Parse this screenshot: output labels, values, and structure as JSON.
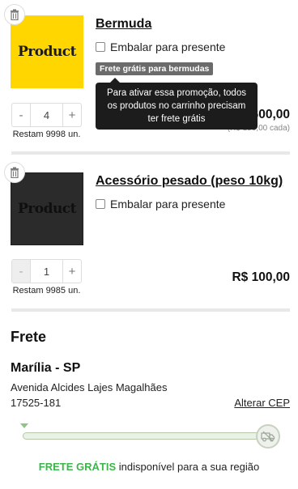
{
  "cart": {
    "items": [
      {
        "thumb_text": "Product",
        "name": "Bermuda",
        "gift_label": "Embalar para presente",
        "promo_badge": "Frete grátis para bermudas",
        "tooltip": "Para ativar essa promoção, todos os produtos no carrinho precisam ter frete grátis",
        "quantity": "4",
        "stock": "Restam 9998 un.",
        "price": "R$ 600,00",
        "unit_price": "(R$ 150,00 cada)",
        "decrement": "-",
        "increment": "+"
      },
      {
        "thumb_text": "Product",
        "name": "Acessório pesado (peso 10kg)",
        "gift_label": "Embalar para presente",
        "quantity": "1",
        "stock": "Restam 9985 un.",
        "price": "R$ 100,00",
        "decrement": "-",
        "increment": "+"
      }
    ]
  },
  "shipping": {
    "title": "Frete",
    "city": "Marília - SP",
    "street": "Avenida Alcides Lajes Magalhães",
    "cep": "17525-181",
    "change_cep": "Alterar CEP",
    "free_label": "FRETE GRÁTIS",
    "unavailable_text": " indisponível para a sua região",
    "progress_fraction": 1.0
  },
  "icons": {
    "remove": "trash-icon",
    "truck": "truck-icon"
  },
  "colors": {
    "accent_green": "#3cb54a",
    "thumb_yellow": "#ffd600",
    "thumb_dark": "#2b2b2b",
    "tooltip_bg": "#1c1c1c"
  }
}
